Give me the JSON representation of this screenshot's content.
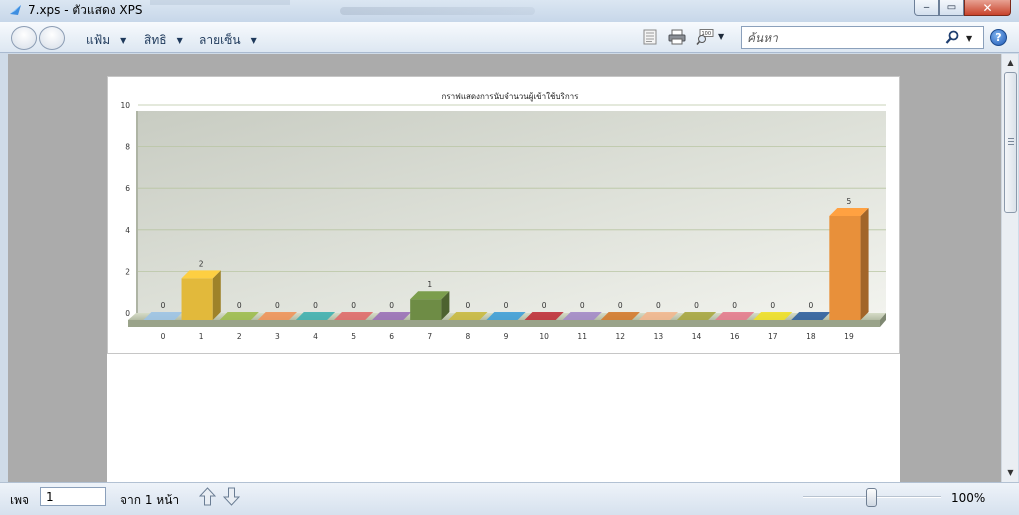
{
  "window": {
    "title": "7.xps - ตัวแสดง XPS",
    "minimize_glyph": "‒",
    "maximize_glyph": "▭",
    "close_glyph": "✕"
  },
  "toolbar": {
    "menus": [
      {
        "label": "แฟ้ม"
      },
      {
        "label": "สิทธิ"
      },
      {
        "label": "ลายเซ็น"
      }
    ],
    "icons": [
      "document-outline-icon",
      "print-icon",
      "zoom-100-icon"
    ],
    "search": {
      "placeholder": "ค้นหา",
      "value": ""
    },
    "help_label": "?"
  },
  "chart_data": {
    "type": "bar",
    "title": "กราฟแสดงการนับจำนวนผู้เข้าใช้บริการ",
    "categories": [
      "0",
      "1",
      "2",
      "3",
      "4",
      "5",
      "6",
      "7",
      "8",
      "9",
      "10",
      "11",
      "12",
      "13",
      "14",
      "16",
      "17",
      "18",
      "19"
    ],
    "values": [
      0,
      2,
      0,
      0,
      0,
      0,
      0,
      1,
      0,
      0,
      0,
      0,
      0,
      0,
      0,
      0,
      0,
      0,
      5
    ],
    "data_labels": [
      "0",
      "2",
      "0",
      "0",
      "0",
      "0",
      "0",
      "1",
      "0",
      "0",
      "0",
      "0",
      "0",
      "0",
      "0",
      "0",
      "0",
      "0",
      "5"
    ],
    "colors": [
      "#9cc3e6",
      "#e2b93b",
      "#9dbd4e",
      "#f0935a",
      "#3fb0b0",
      "#e06a6a",
      "#9a70b8",
      "#6e8c45",
      "#c9b940",
      "#3f9ed8",
      "#c0303a",
      "#a38ac8",
      "#d47a2e",
      "#f2b78f",
      "#a7a640",
      "#e57b8e",
      "#efe026",
      "#2f5f9e",
      "#e8903a"
    ],
    "ylim": [
      0,
      10
    ],
    "yticks": [
      "0",
      "2",
      "4",
      "6",
      "8",
      "10"
    ],
    "grid": true,
    "style": "3d"
  },
  "statusbar": {
    "page_label": "เพจ",
    "page_value": "1",
    "of_pages": "จาก 1 หน้า",
    "zoom_percent": 100,
    "zoom_label": "100%"
  }
}
